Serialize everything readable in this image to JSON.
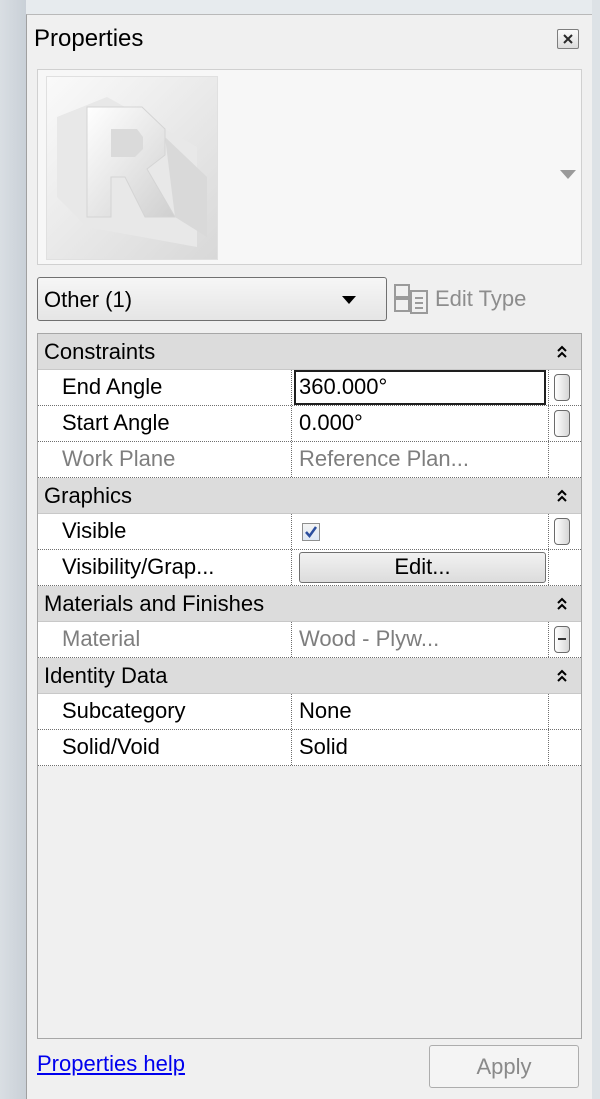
{
  "window": {
    "title": "Properties"
  },
  "type_selector": {
    "value": "Other (1)",
    "edit_type_label": "Edit Type"
  },
  "groups": [
    {
      "label": "Constraints",
      "properties": [
        {
          "name": "End Angle",
          "value": "360.000°",
          "state": "editing"
        },
        {
          "name": "Start Angle",
          "value": "0.000°"
        },
        {
          "name": "Work Plane",
          "value": "Reference Plan...",
          "disabled": true
        }
      ]
    },
    {
      "label": "Graphics",
      "properties": [
        {
          "name": "Visible",
          "checked": true
        },
        {
          "name": "Visibility/Grap...",
          "button_label": "Edit..."
        }
      ]
    },
    {
      "label": "Materials and Finishes",
      "properties": [
        {
          "name": "Material",
          "value": "Wood - Plyw...",
          "disabled": true
        }
      ]
    },
    {
      "label": "Identity Data",
      "properties": [
        {
          "name": "Subcategory",
          "value": "None"
        },
        {
          "name": "Solid/Void",
          "value": "Solid"
        }
      ]
    }
  ],
  "footer": {
    "help_link": "Properties help",
    "apply_label": "Apply"
  }
}
